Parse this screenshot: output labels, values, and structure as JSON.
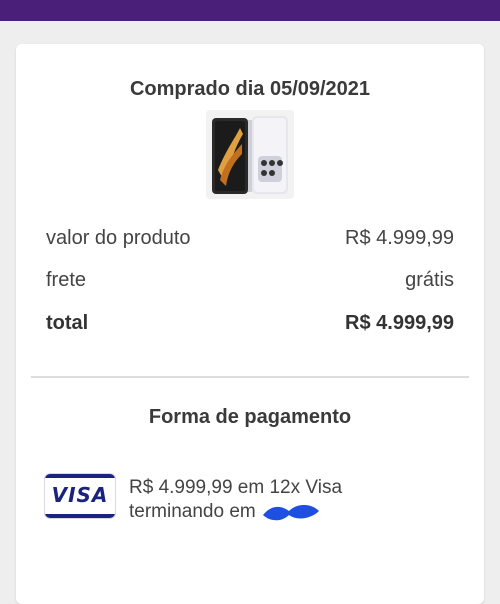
{
  "header": {
    "bar_color": "#4a1f7a"
  },
  "order": {
    "purchased_label": "Comprado dia 05/09/2021",
    "product_image_icon": "phone-product-image"
  },
  "summary": {
    "product_value_label": "valor do produto",
    "product_value": "R$ 4.999,99",
    "shipping_label": "frete",
    "shipping_value": "grátis",
    "total_label": "total",
    "total_value": "R$ 4.999,99"
  },
  "payment": {
    "title": "Forma de pagamento",
    "card_brand": "VISA",
    "line1": "R$ 4.999,99 em 12x Visa",
    "line2_prefix": "terminando em"
  }
}
